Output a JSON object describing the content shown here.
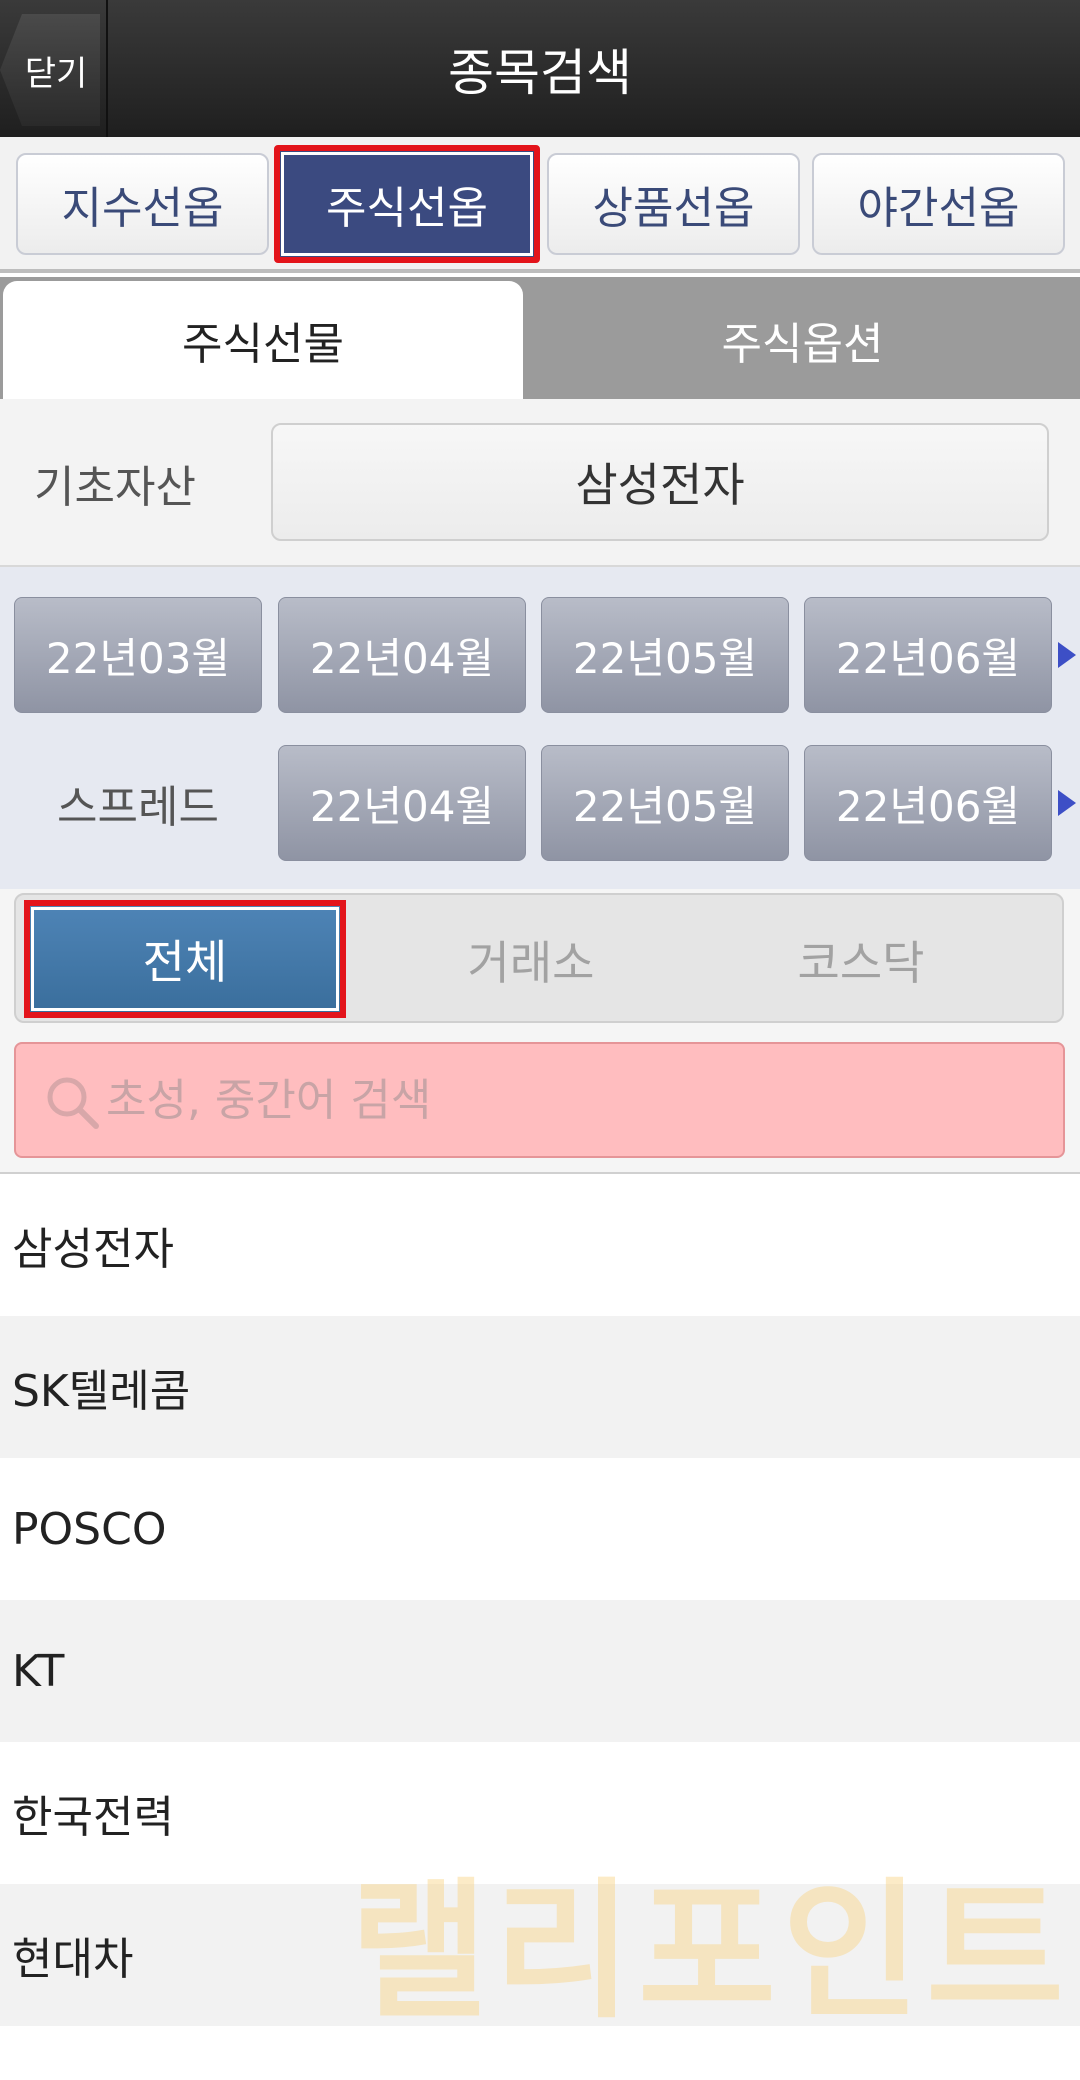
{
  "header": {
    "close_label": "닫기",
    "title": "종목검색"
  },
  "market_tabs": [
    {
      "label": "지수선옵",
      "active": false
    },
    {
      "label": "주식선옵",
      "active": true
    },
    {
      "label": "상품선옵",
      "active": false
    },
    {
      "label": "야간선옵",
      "active": false
    }
  ],
  "type_tabs": [
    {
      "label": "주식선물",
      "active": true
    },
    {
      "label": "주식옵션",
      "active": false
    }
  ],
  "underlying": {
    "label": "기초자산",
    "value": "삼성전자"
  },
  "months": {
    "row1": [
      "22년03월",
      "22년04월",
      "22년05월",
      "22년06월"
    ],
    "spread_label": "스프레드",
    "row2": [
      "22년04월",
      "22년05월",
      "22년06월"
    ],
    "arrow_icon": "triangle-right",
    "arrow_color": "#3d4fc6"
  },
  "exchange_filter": [
    {
      "label": "전체",
      "active": true
    },
    {
      "label": "거래소",
      "active": false
    },
    {
      "label": "코스닥",
      "active": false
    }
  ],
  "search": {
    "placeholder": "초성, 중간어 검색",
    "value": ""
  },
  "stocks": [
    "삼성전자",
    "SK텔레콤",
    "POSCO",
    "KT",
    "한국전력",
    "현대차"
  ],
  "watermark": "랠리포인트",
  "colors": {
    "active_market_tab": "#3b4a80",
    "active_filter": "#4479a8",
    "highlight_border": "#e3141b",
    "search_bg": "#ffbdbf"
  }
}
